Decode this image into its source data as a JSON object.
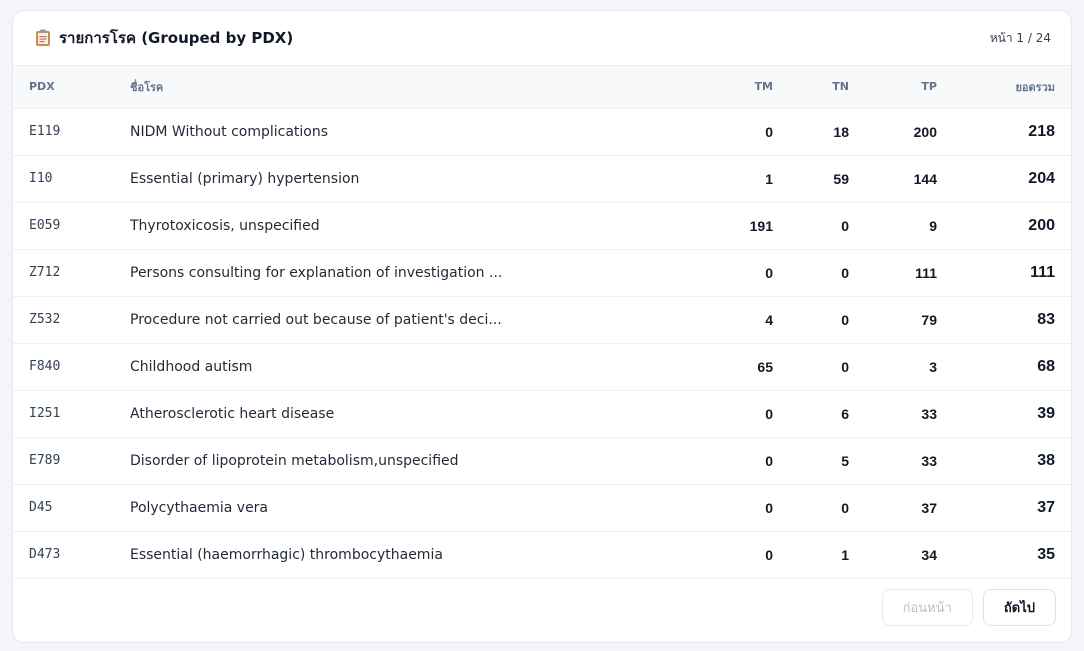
{
  "header": {
    "icon": "clipboard-icon",
    "title": "รายการโรค (Grouped by PDX)",
    "page_indicator": "หน้า 1 / 24"
  },
  "table": {
    "columns": {
      "pdx": "PDX",
      "name": "ชื่อโรค",
      "tm": "TM",
      "tn": "TN",
      "tp": "TP",
      "total": "ยอดรวม"
    },
    "rows": [
      {
        "pdx": "E119",
        "name": "NIDM Without complications",
        "tm": "0",
        "tn": "18",
        "tp": "200",
        "total": "218"
      },
      {
        "pdx": "I10",
        "name": "Essential (primary) hypertension",
        "tm": "1",
        "tn": "59",
        "tp": "144",
        "total": "204"
      },
      {
        "pdx": "E059",
        "name": "Thyrotoxicosis, unspecified",
        "tm": "191",
        "tn": "0",
        "tp": "9",
        "total": "200"
      },
      {
        "pdx": "Z712",
        "name": "Persons consulting for explanation of investigation ...",
        "tm": "0",
        "tn": "0",
        "tp": "111",
        "total": "111"
      },
      {
        "pdx": "Z532",
        "name": "Procedure not carried out because of patient's deci...",
        "tm": "4",
        "tn": "0",
        "tp": "79",
        "total": "83"
      },
      {
        "pdx": "F840",
        "name": "Childhood autism",
        "tm": "65",
        "tn": "0",
        "tp": "3",
        "total": "68"
      },
      {
        "pdx": "I251",
        "name": "Atherosclerotic heart disease",
        "tm": "0",
        "tn": "6",
        "tp": "33",
        "total": "39"
      },
      {
        "pdx": "E789",
        "name": "Disorder of lipoprotein metabolism,unspecified",
        "tm": "0",
        "tn": "5",
        "tp": "33",
        "total": "38"
      },
      {
        "pdx": "D45",
        "name": "Polycythaemia vera",
        "tm": "0",
        "tn": "0",
        "tp": "37",
        "total": "37"
      },
      {
        "pdx": "D473",
        "name": "Essential (haemorrhagic) thrombocythaemia",
        "tm": "0",
        "tn": "1",
        "tp": "34",
        "total": "35"
      }
    ]
  },
  "pagination": {
    "prev_label": "ก่อนหน้า",
    "next_label": "ถัดไป"
  }
}
